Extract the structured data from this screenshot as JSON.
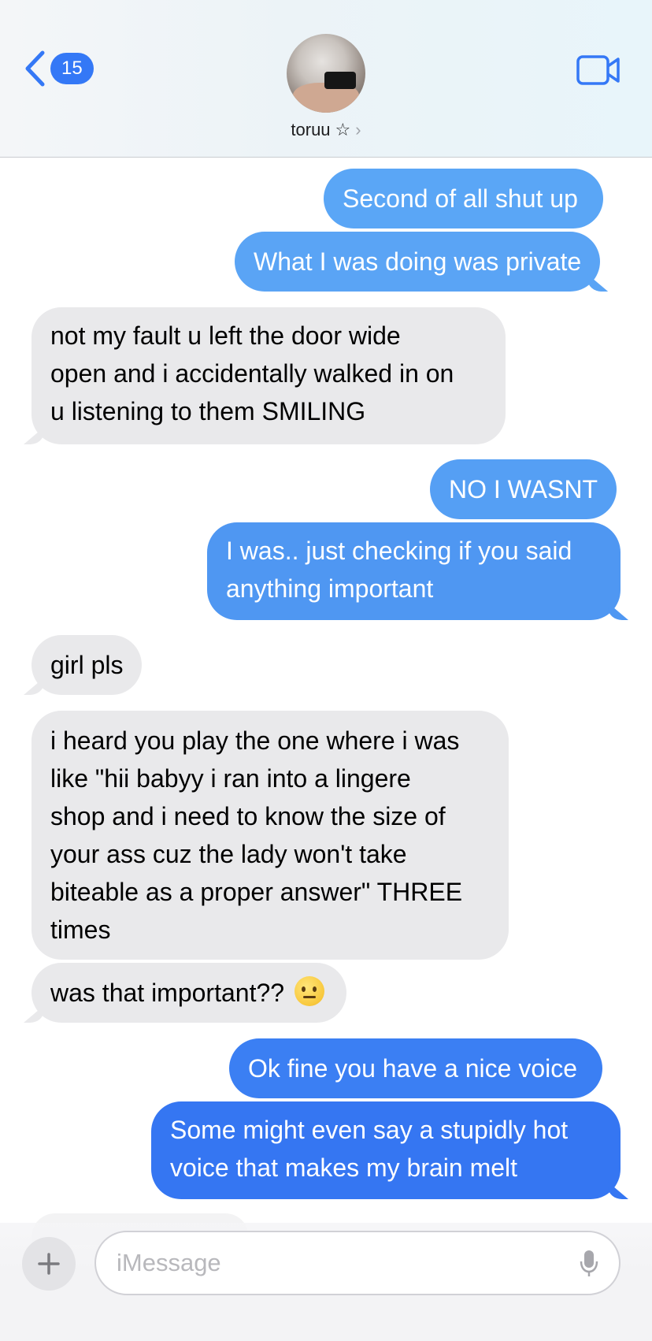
{
  "header": {
    "back_count": "15",
    "contact_name": "toruu",
    "star": "☆",
    "chevron": "›"
  },
  "messages": [
    {
      "from": "me",
      "text": "Second of all shut up"
    },
    {
      "from": "me",
      "text": "What I was doing was private"
    },
    {
      "from": "them",
      "lines": [
        "not my fault u left the door wide",
        "open and i accidentally walked in on",
        "u listening to them SMILING"
      ]
    },
    {
      "from": "me",
      "text": "NO I WASNT"
    },
    {
      "from": "me",
      "lines": [
        "I was.. just checking if you said",
        "anything important"
      ]
    },
    {
      "from": "them",
      "text": "girl pls"
    },
    {
      "from": "them",
      "lines": [
        "i heard you play the one where i was",
        "like \"hii babyy i ran into a lingere",
        "shop and i need to know the size of",
        "your ass cuz the lady won't take",
        "biteable as a proper answer\" THREE",
        "times"
      ]
    },
    {
      "from": "them",
      "text": "was that important??",
      "emoji": "face-with-raised-eyebrow"
    },
    {
      "from": "me",
      "text": "Ok fine you have a nice voice"
    },
    {
      "from": "me",
      "lines": [
        "Some might even say a stupidly hot",
        "voice that makes my brain melt"
      ]
    }
  ],
  "input": {
    "placeholder": "iMessage"
  },
  "colors": {
    "sent_bubble_light": "#5aa5f5",
    "sent_bubble_dark": "#3478f6",
    "received_bubble": "#e9e9eb",
    "accent": "#3478f6"
  },
  "icons": {
    "back": "chevron-left-icon",
    "video": "video-camera-icon",
    "add": "plus-icon",
    "mic": "microphone-icon"
  }
}
